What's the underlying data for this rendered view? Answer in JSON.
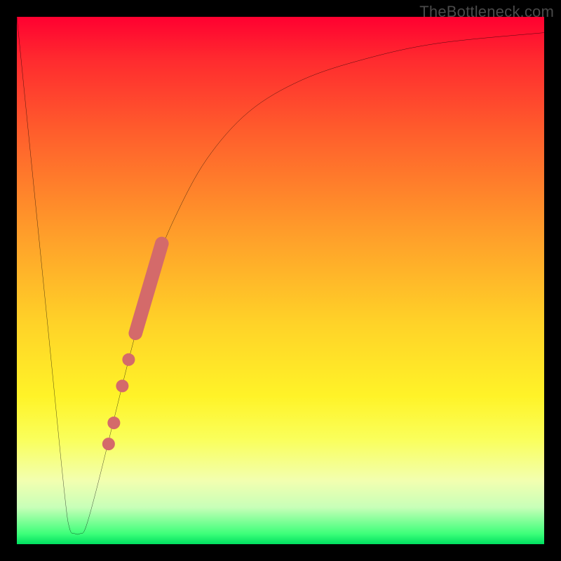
{
  "watermark": "TheBottleneck.com",
  "colors": {
    "frame": "#000000",
    "curve_stroke": "#000000",
    "marker_fill": "#d46a6a",
    "gradient_stops": [
      "#ff0030",
      "#ff2a2f",
      "#ff5e2c",
      "#ff9a2a",
      "#ffd228",
      "#fff328",
      "#faff5a",
      "#f2ffb0",
      "#c8ffb8",
      "#3eff7a",
      "#00e060"
    ]
  },
  "chart_data": {
    "type": "line",
    "title": "",
    "xlabel": "",
    "ylabel": "",
    "xlim": [
      0,
      100
    ],
    "ylim": [
      0,
      100
    ],
    "grid": false,
    "legend": false,
    "curve": [
      {
        "x": 0,
        "y": 100
      },
      {
        "x": 6,
        "y": 40
      },
      {
        "x": 9,
        "y": 10
      },
      {
        "x": 10,
        "y": 3
      },
      {
        "x": 11,
        "y": 2
      },
      {
        "x": 12,
        "y": 2
      },
      {
        "x": 13,
        "y": 3
      },
      {
        "x": 15,
        "y": 10
      },
      {
        "x": 18,
        "y": 22
      },
      {
        "x": 22,
        "y": 38
      },
      {
        "x": 26,
        "y": 52
      },
      {
        "x": 30,
        "y": 62
      },
      {
        "x": 36,
        "y": 73
      },
      {
        "x": 44,
        "y": 82
      },
      {
        "x": 54,
        "y": 88
      },
      {
        "x": 66,
        "y": 92
      },
      {
        "x": 80,
        "y": 95
      },
      {
        "x": 100,
        "y": 97
      }
    ],
    "marker_band": {
      "start": {
        "x": 22.5,
        "y": 40
      },
      "end": {
        "x": 27.5,
        "y": 57
      },
      "width": 2.6
    },
    "marker_points": [
      {
        "x": 21.2,
        "y": 35,
        "r": 1.2
      },
      {
        "x": 20.0,
        "y": 30,
        "r": 1.2
      },
      {
        "x": 18.4,
        "y": 23,
        "r": 1.2
      },
      {
        "x": 17.4,
        "y": 19,
        "r": 1.2
      }
    ]
  }
}
